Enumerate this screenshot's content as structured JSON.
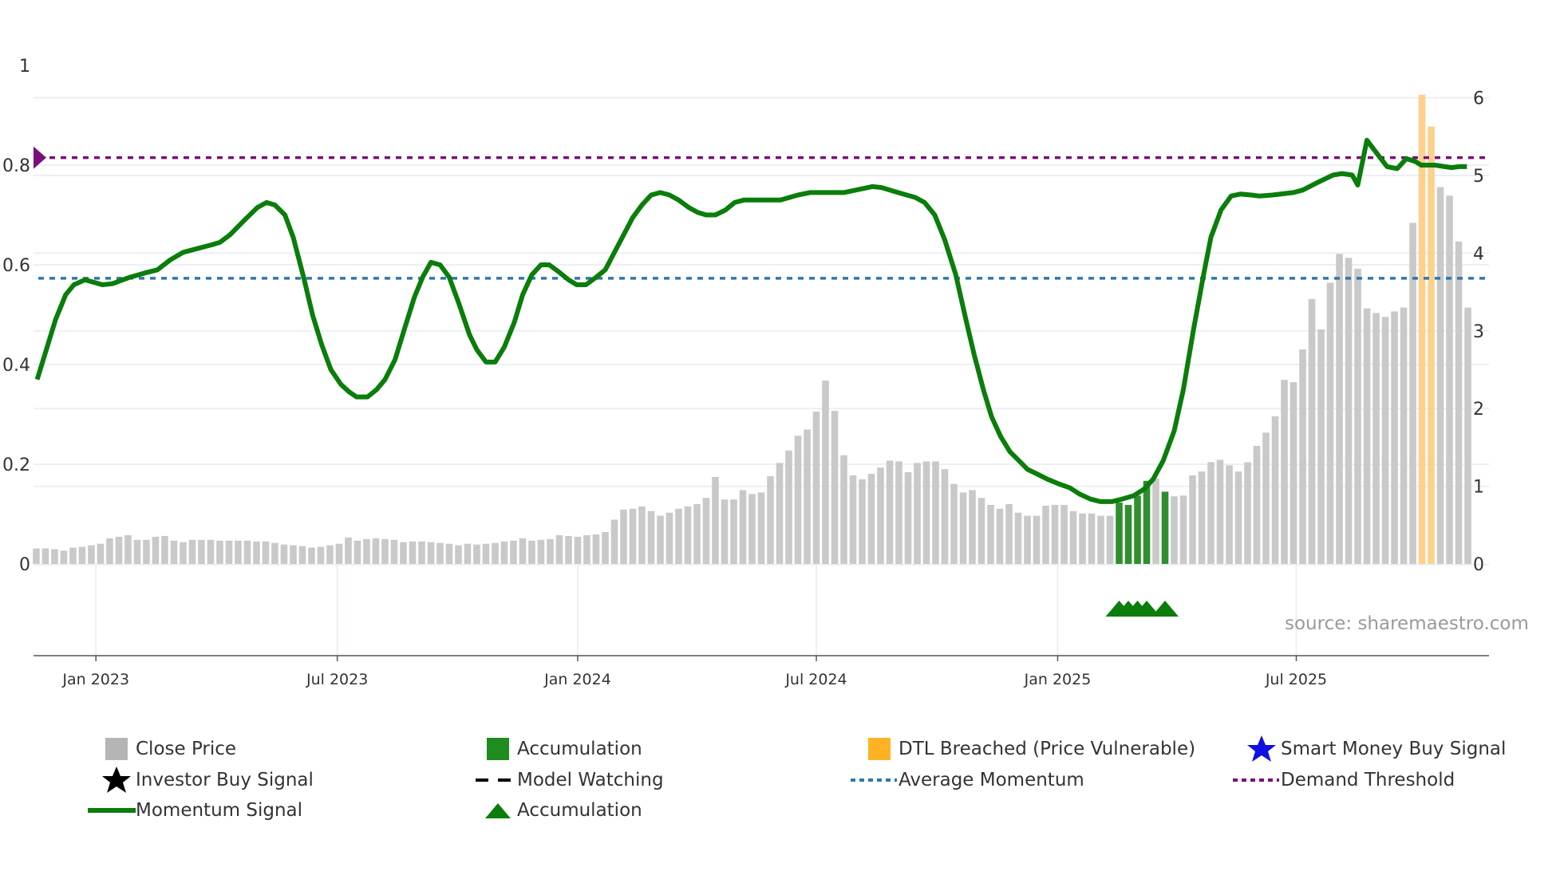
{
  "chart_data": {
    "type": "bar+line",
    "title": "",
    "source": "source: sharemaestro.com",
    "left_axis": {
      "ticks": [
        "0",
        "0.2",
        "0.4",
        "0.6",
        "0.8",
        "1"
      ],
      "values": [
        0,
        0.2,
        0.4,
        0.6,
        0.8,
        1
      ],
      "range": [
        0,
        1
      ]
    },
    "right_axis": {
      "ticks": [
        "0",
        "1",
        "2",
        "3",
        "4",
        "5",
        "6"
      ],
      "values": [
        0,
        1,
        2,
        3,
        4,
        5,
        6
      ],
      "range": [
        0,
        6.1
      ]
    },
    "x_axis": {
      "unit": "week index",
      "ticks": [
        {
          "label": "Jan 2023",
          "week": 6.5
        },
        {
          "label": "Jul 2023",
          "week": 32.8
        },
        {
          "label": "Jan 2024",
          "week": 59
        },
        {
          "label": "Jul 2024",
          "week": 85
        },
        {
          "label": "Jan 2025",
          "week": 111.3
        },
        {
          "label": "Jul 2025",
          "week": 137.3
        }
      ],
      "range": [
        -0.3,
        158.3
      ]
    },
    "close_price": [
      0.2,
      0.2,
      0.19,
      0.17,
      0.21,
      0.22,
      0.24,
      0.26,
      0.33,
      0.35,
      0.37,
      0.31,
      0.31,
      0.35,
      0.36,
      0.3,
      0.28,
      0.31,
      0.31,
      0.31,
      0.3,
      0.3,
      0.3,
      0.3,
      0.29,
      0.29,
      0.27,
      0.25,
      0.24,
      0.23,
      0.21,
      0.22,
      0.24,
      0.26,
      0.34,
      0.3,
      0.32,
      0.33,
      0.32,
      0.31,
      0.28,
      0.29,
      0.29,
      0.28,
      0.27,
      0.26,
      0.24,
      0.26,
      0.25,
      0.26,
      0.27,
      0.29,
      0.3,
      0.33,
      0.3,
      0.31,
      0.32,
      0.37,
      0.36,
      0.35,
      0.37,
      0.38,
      0.41,
      0.57,
      0.7,
      0.71,
      0.74,
      0.68,
      0.62,
      0.66,
      0.71,
      0.74,
      0.77,
      0.85,
      1.12,
      0.83,
      0.83,
      0.95,
      0.9,
      0.92,
      1.13,
      1.3,
      1.46,
      1.65,
      1.73,
      1.96,
      2.36,
      1.97,
      1.4,
      1.14,
      1.09,
      1.16,
      1.24,
      1.33,
      1.32,
      1.18,
      1.3,
      1.32,
      1.32,
      1.22,
      1.03,
      0.92,
      0.95,
      0.85,
      0.76,
      0.71,
      0.77,
      0.66,
      0.62,
      0.62,
      0.75,
      0.76,
      0.76,
      0.68,
      0.65,
      0.65,
      0.62,
      0.62,
      0.79,
      0.76,
      0.88,
      1.07,
      1.1,
      0.93,
      0.87,
      0.88,
      1.14,
      1.19,
      1.31,
      1.34,
      1.27,
      1.19,
      1.31,
      1.52,
      1.69,
      1.9,
      2.37,
      2.34,
      2.76,
      3.41,
      3.02,
      3.62,
      3.99,
      3.94,
      3.8,
      3.29,
      3.23,
      3.18,
      3.25,
      3.3,
      4.39,
      6.04,
      5.63,
      4.85,
      4.74,
      4.15,
      3.3
    ],
    "accumulation_weeks": [
      118,
      119,
      120,
      121,
      123
    ],
    "dtl_breached_weeks": [
      151,
      152
    ],
    "accumulation_marker_weeks": [
      118,
      119,
      120,
      121,
      123
    ],
    "momentum": [
      [
        0.1,
        0.37
      ],
      [
        2.1,
        0.49
      ],
      [
        3.2,
        0.54
      ],
      [
        4.1,
        0.56
      ],
      [
        5.3,
        0.57
      ],
      [
        7.2,
        0.56
      ],
      [
        8.3,
        0.562
      ],
      [
        10.2,
        0.575
      ],
      [
        12.1,
        0.585
      ],
      [
        13.2,
        0.59
      ],
      [
        14.6,
        0.61
      ],
      [
        16,
        0.625
      ],
      [
        17,
        0.63
      ],
      [
        19.1,
        0.64
      ],
      [
        20,
        0.645
      ],
      [
        21.1,
        0.66
      ],
      [
        22.7,
        0.69
      ],
      [
        24.1,
        0.715
      ],
      [
        25.1,
        0.725
      ],
      [
        26,
        0.72
      ],
      [
        27.1,
        0.7
      ],
      [
        28,
        0.655
      ],
      [
        29.2,
        0.57
      ],
      [
        30.1,
        0.5
      ],
      [
        31.1,
        0.44
      ],
      [
        32.1,
        0.39
      ],
      [
        33.2,
        0.36
      ],
      [
        34.1,
        0.345
      ],
      [
        34.9,
        0.335
      ],
      [
        36.1,
        0.335
      ],
      [
        37.1,
        0.35
      ],
      [
        38,
        0.37
      ],
      [
        39.1,
        0.41
      ],
      [
        40.1,
        0.47
      ],
      [
        41.2,
        0.535
      ],
      [
        42.1,
        0.575
      ],
      [
        43,
        0.605
      ],
      [
        44,
        0.6
      ],
      [
        45,
        0.575
      ],
      [
        46.1,
        0.52
      ],
      [
        47.2,
        0.46
      ],
      [
        48,
        0.43
      ],
      [
        49,
        0.405
      ],
      [
        50,
        0.405
      ],
      [
        51,
        0.435
      ],
      [
        52.1,
        0.485
      ],
      [
        53,
        0.54
      ],
      [
        54,
        0.58
      ],
      [
        55,
        0.6
      ],
      [
        55.9,
        0.6
      ],
      [
        57,
        0.585
      ],
      [
        58,
        0.57
      ],
      [
        58.9,
        0.56
      ],
      [
        59.9,
        0.56
      ],
      [
        61,
        0.575
      ],
      [
        62,
        0.59
      ],
      [
        63,
        0.625
      ],
      [
        64,
        0.66
      ],
      [
        65,
        0.695
      ],
      [
        66,
        0.72
      ],
      [
        67,
        0.74
      ],
      [
        68,
        0.745
      ],
      [
        69,
        0.74
      ],
      [
        70,
        0.73
      ],
      [
        71.1,
        0.715
      ],
      [
        72.1,
        0.705
      ],
      [
        73,
        0.7
      ],
      [
        74,
        0.7
      ],
      [
        75.1,
        0.71
      ],
      [
        76.1,
        0.725
      ],
      [
        77.1,
        0.73
      ],
      [
        78.2,
        0.73
      ],
      [
        81.1,
        0.73
      ],
      [
        83,
        0.74
      ],
      [
        84.3,
        0.745
      ],
      [
        88,
        0.745
      ],
      [
        91.1,
        0.757
      ],
      [
        92.1,
        0.755
      ],
      [
        93.9,
        0.745
      ],
      [
        95.8,
        0.735
      ],
      [
        96.8,
        0.725
      ],
      [
        97.9,
        0.7
      ],
      [
        99,
        0.65
      ],
      [
        100.2,
        0.58
      ],
      [
        101.3,
        0.49
      ],
      [
        102.2,
        0.42
      ],
      [
        103.2,
        0.35
      ],
      [
        104.1,
        0.295
      ],
      [
        105.1,
        0.255
      ],
      [
        106.1,
        0.225
      ],
      [
        107.2,
        0.205
      ],
      [
        108,
        0.19
      ],
      [
        109.1,
        0.18
      ],
      [
        110.2,
        0.17
      ],
      [
        111.5,
        0.16
      ],
      [
        112.6,
        0.153
      ],
      [
        113.7,
        0.14
      ],
      [
        114.9,
        0.13
      ],
      [
        116,
        0.125
      ],
      [
        117.2,
        0.125
      ],
      [
        118.3,
        0.13
      ],
      [
        119.6,
        0.137
      ],
      [
        120.7,
        0.15
      ],
      [
        121.7,
        0.17
      ],
      [
        122.8,
        0.207
      ],
      [
        124,
        0.267
      ],
      [
        125,
        0.35
      ],
      [
        126.1,
        0.47
      ],
      [
        127.2,
        0.58
      ],
      [
        128,
        0.655
      ],
      [
        129.1,
        0.71
      ],
      [
        130.2,
        0.738
      ],
      [
        131.2,
        0.742
      ],
      [
        132.4,
        0.74
      ],
      [
        133.3,
        0.738
      ],
      [
        134.7,
        0.74
      ],
      [
        137,
        0.745
      ],
      [
        138,
        0.75
      ],
      [
        139.6,
        0.765
      ],
      [
        141.3,
        0.78
      ],
      [
        142.3,
        0.783
      ],
      [
        143.4,
        0.78
      ],
      [
        144,
        0.76
      ],
      [
        145,
        0.85
      ],
      [
        146.1,
        0.823
      ],
      [
        147.2,
        0.797
      ],
      [
        148.3,
        0.793
      ],
      [
        149.3,
        0.813
      ],
      [
        150.3,
        0.807
      ],
      [
        150.9,
        0.8
      ],
      [
        152.4,
        0.8
      ],
      [
        154.2,
        0.795
      ],
      [
        155.1,
        0.797
      ],
      [
        155.9,
        0.797
      ]
    ],
    "average_momentum": 0.573,
    "demand_threshold": 0.815,
    "legend": [
      {
        "label": "Close Price",
        "icon": "gray-square"
      },
      {
        "label": "Accumulation",
        "icon": "green-square"
      },
      {
        "label": "DTL Breached (Price Vulnerable)",
        "icon": "orange-square"
      },
      {
        "label": "Smart Money Buy Signal",
        "icon": "blue-star"
      },
      {
        "label": "Investor Buy Signal",
        "icon": "black-star"
      },
      {
        "label": "Model Watching",
        "icon": "black-dashed-line"
      },
      {
        "label": "Average Momentum",
        "icon": "blue-dotted-line"
      },
      {
        "label": "Demand Threshold",
        "icon": "purple-dotted-line"
      },
      {
        "label": "Momentum Signal",
        "icon": "green-line"
      },
      {
        "label": "Accumulation",
        "icon": "green-triangle"
      }
    ],
    "legend_placement": "bottom",
    "colors": {
      "close_price": "#c9c9c9",
      "close_legend": "#b5b5b5",
      "accumulation": "#2f8f2f",
      "accumulation_legend": "#1e8c1e",
      "dtl": "#fdd18c",
      "dtl_legend": "#ffb224",
      "momentum": "#0a7d0a",
      "avg_momentum": "#2e77b0",
      "demand": "#7a0f7a",
      "smart_money": "#1010e0",
      "grid": "#eceff4"
    }
  }
}
